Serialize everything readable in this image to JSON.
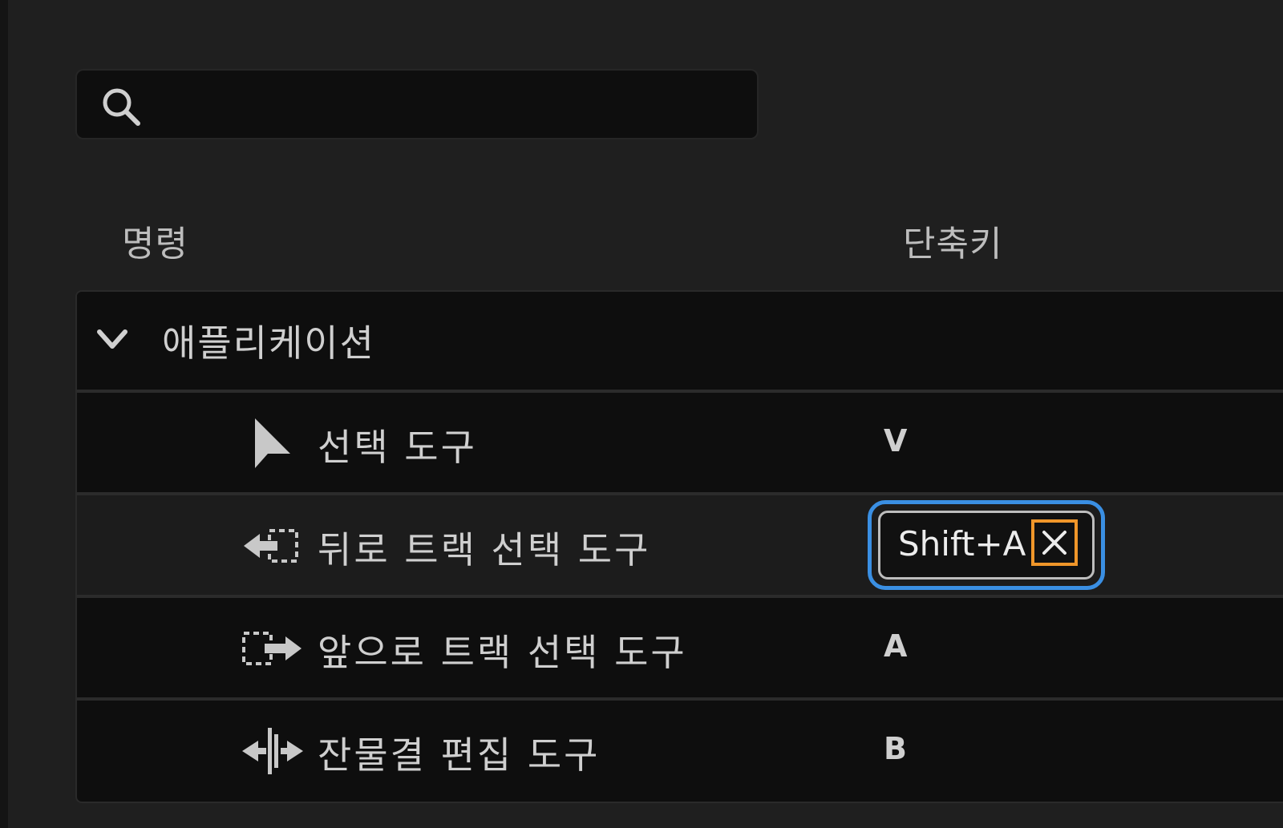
{
  "search": {
    "value": "",
    "placeholder": ""
  },
  "columns": {
    "command": "명령",
    "shortcut": "단축키"
  },
  "group": {
    "label": "애플리케이션",
    "expanded": true
  },
  "rows": [
    {
      "label": "선택 도구",
      "shortcut": "V",
      "icon": "selection-arrow-icon"
    },
    {
      "label": "뒤로 트랙 선택 도구",
      "shortcut": "Shift+A",
      "icon": "track-select-backward-icon",
      "editing": true
    },
    {
      "label": "앞으로 트랙 선택 도구",
      "shortcut": "A",
      "icon": "track-select-forward-icon"
    },
    {
      "label": "잔물결 편집 도구",
      "shortcut": "B",
      "icon": "ripple-edit-icon"
    }
  ],
  "colors": {
    "focus_ring": "#3a8fe3",
    "clear_highlight": "#f0962a",
    "panel_bg": "#1f1f1f",
    "row_bg": "#0e0e0e",
    "selected_row_bg": "#1c1c1c"
  }
}
